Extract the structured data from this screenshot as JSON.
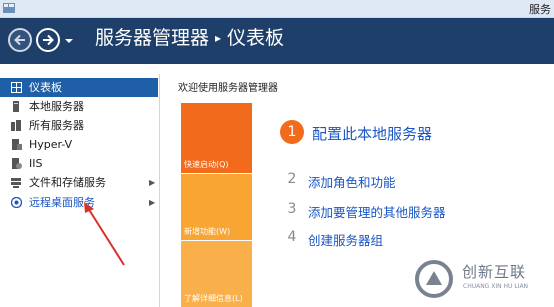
{
  "window": {
    "title": "服务"
  },
  "header": {
    "breadcrumb": [
      "服务器管理器",
      "仪表板"
    ]
  },
  "sidebar": {
    "items": [
      {
        "label": "仪表板",
        "icon": "dashboard-icon",
        "selected": true,
        "expandable": false
      },
      {
        "label": "本地服务器",
        "icon": "server-icon",
        "selected": false,
        "expandable": false
      },
      {
        "label": "所有服务器",
        "icon": "servers-icon",
        "selected": false,
        "expandable": false
      },
      {
        "label": "Hyper-V",
        "icon": "hyperv-icon",
        "selected": false,
        "expandable": false
      },
      {
        "label": "IIS",
        "icon": "iis-icon",
        "selected": false,
        "expandable": false
      },
      {
        "label": "文件和存储服务",
        "icon": "storage-icon",
        "selected": false,
        "expandable": true
      },
      {
        "label": "远程桌面服务",
        "icon": "remote-desktop-icon",
        "selected": false,
        "expandable": true
      }
    ]
  },
  "main": {
    "welcome_title": "欢迎使用服务器管理器",
    "tiles": {
      "quick_start": "快速启动(Q)",
      "new_features": "新增功能(W)",
      "learn_more": "了解详细信息(L)"
    },
    "steps": [
      {
        "num": "1",
        "label": "配置此本地服务器"
      },
      {
        "num": "2",
        "label": "添加角色和功能"
      },
      {
        "num": "3",
        "label": "添加要管理的其他服务器"
      },
      {
        "num": "4",
        "label": "创建服务器组"
      }
    ]
  },
  "watermark": {
    "name": "创新互联",
    "sub": "CHUANG XIN HU LIAN"
  },
  "colors": {
    "header": "#1f3f6b",
    "selected": "#1f5fa8",
    "accent_orange": "#f26a1b",
    "tile_yellow": "#f9a534",
    "link_blue": "#1a56c4",
    "arrow_red": "#d9322b"
  }
}
